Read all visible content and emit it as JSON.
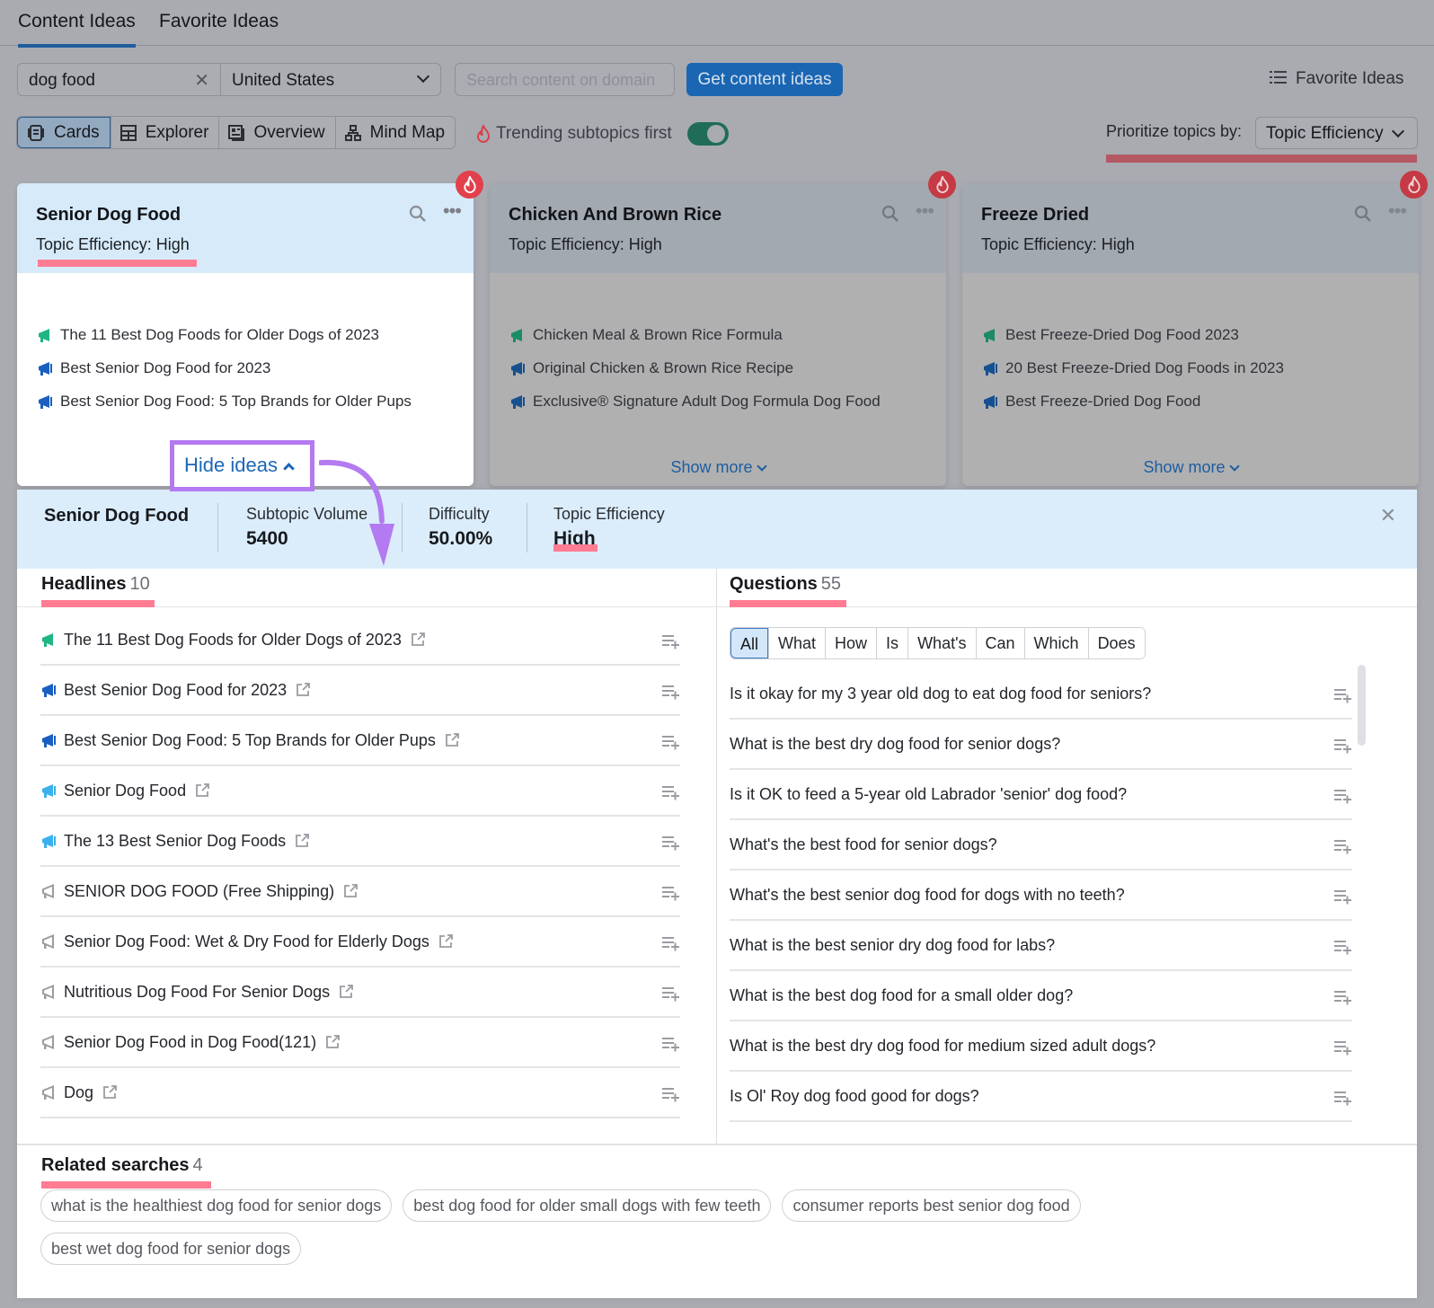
{
  "colors": {
    "accent_blue": "#1b66b3",
    "highlight_pink": "#ff7c93",
    "annotation_purple": "#b37af1",
    "fire_red": "#e2404b",
    "toggle_green": "#1f6d56",
    "idea_green": "#1fb584",
    "idea_blue_dark": "#1a5fbf",
    "idea_blue_light": "#3ab1ec",
    "idea_gray": "#9a9ca2"
  },
  "top_tabs": [
    {
      "label": "Content Ideas",
      "active": true
    },
    {
      "label": "Favorite Ideas",
      "active": false
    }
  ],
  "search": {
    "keyword_value": "dog food",
    "clear_icon": "close-icon",
    "country_value": "United States",
    "domain_placeholder": "Search content on domain",
    "submit_label": "Get content ideas",
    "favorite_link_label": "Favorite Ideas"
  },
  "views": [
    {
      "label": "Cards",
      "icon": "cards-icon",
      "active": true
    },
    {
      "label": "Explorer",
      "icon": "table-icon",
      "active": false
    },
    {
      "label": "Overview",
      "icon": "overview-icon",
      "active": false
    },
    {
      "label": "Mind Map",
      "icon": "mindmap-icon",
      "active": false
    }
  ],
  "trending": {
    "label": "Trending subtopics first",
    "enabled": true
  },
  "prioritize": {
    "label": "Prioritize topics by:",
    "value": "Topic Efficiency"
  },
  "cards": [
    {
      "title": "Senior Dog Food",
      "efficiency": "Topic Efficiency: High",
      "trending": true,
      "expanded": true,
      "ideas": [
        {
          "text": "The 11 Best Dog Foods for Older Dogs of 2023",
          "level": "green"
        },
        {
          "text": "Best Senior Dog Food for 2023",
          "level": "blue"
        },
        {
          "text": "Best Senior Dog Food: 5 Top Brands for Older Pups",
          "level": "blue"
        }
      ],
      "toggle_label": "Hide ideas"
    },
    {
      "title": "Chicken And Brown Rice",
      "efficiency": "Topic Efficiency: High",
      "trending": true,
      "expanded": false,
      "ideas": [
        {
          "text": "Chicken Meal & Brown Rice Formula",
          "level": "green"
        },
        {
          "text": "Original Chicken & Brown Rice Recipe",
          "level": "blue"
        },
        {
          "text": "Exclusive® Signature Adult Dog Formula Dog Food",
          "level": "blue"
        }
      ],
      "toggle_label": "Show more"
    },
    {
      "title": "Freeze Dried",
      "efficiency": "Topic Efficiency: High",
      "trending": true,
      "expanded": false,
      "ideas": [
        {
          "text": "Best Freeze-Dried Dog Food 2023",
          "level": "green"
        },
        {
          "text": "20 Best Freeze-Dried Dog Foods in 2023",
          "level": "blue"
        },
        {
          "text": "Best Freeze-Dried Dog Food",
          "level": "blue"
        }
      ],
      "toggle_label": "Show more"
    }
  ],
  "detail": {
    "title": "Senior Dog Food",
    "metrics": [
      {
        "label": "Subtopic Volume",
        "value": "5400"
      },
      {
        "label": "Difficulty",
        "value": "50.00%"
      },
      {
        "label": "Topic Efficiency",
        "value": "High"
      }
    ],
    "close_icon": "close-icon",
    "headlines": {
      "title": "Headlines",
      "count": "10",
      "items": [
        {
          "text": "The 11 Best Dog Foods for Older Dogs of 2023",
          "level": "green"
        },
        {
          "text": "Best Senior Dog Food for 2023",
          "level": "blue"
        },
        {
          "text": "Best Senior Dog Food: 5 Top Brands for Older Pups",
          "level": "blue"
        },
        {
          "text": "Senior Dog Food",
          "level": "light"
        },
        {
          "text": "The 13 Best Senior Dog Foods",
          "level": "light"
        },
        {
          "text": "SENIOR DOG FOOD (Free Shipping)",
          "level": "gray"
        },
        {
          "text": "Senior Dog Food: Wet & Dry Food for Elderly Dogs",
          "level": "gray"
        },
        {
          "text": "Nutritious Dog Food For Senior Dogs",
          "level": "gray"
        },
        {
          "text": "Senior Dog Food in Dog Food(121)",
          "level": "gray"
        },
        {
          "text": "Dog",
          "level": "gray"
        }
      ]
    },
    "questions": {
      "title": "Questions",
      "count": "55",
      "filters": [
        "All",
        "What",
        "How",
        "Is",
        "What's",
        "Can",
        "Which",
        "Does"
      ],
      "active_filter": "All",
      "items": [
        "Is it okay for my 3 year old dog to eat dog food for seniors?",
        "What is the best dry dog food for senior dogs?",
        "Is it OK to feed a 5-year old Labrador 'senior' dog food?",
        "What's the best food for senior dogs?",
        "What's the best senior dog food for dogs with no teeth?",
        "What is the best senior dry dog food for labs?",
        "What is the best dog food for a small older dog?",
        "What is the best dry dog food for medium sized adult dogs?",
        "Is Ol' Roy dog food good for dogs?"
      ]
    },
    "related": {
      "title": "Related searches",
      "count": "4",
      "items": [
        "what is the healthiest dog food for senior dogs",
        "best dog food for older small dogs with few teeth",
        "consumer reports best senior dog food",
        "best wet dog food for senior dogs"
      ]
    }
  }
}
